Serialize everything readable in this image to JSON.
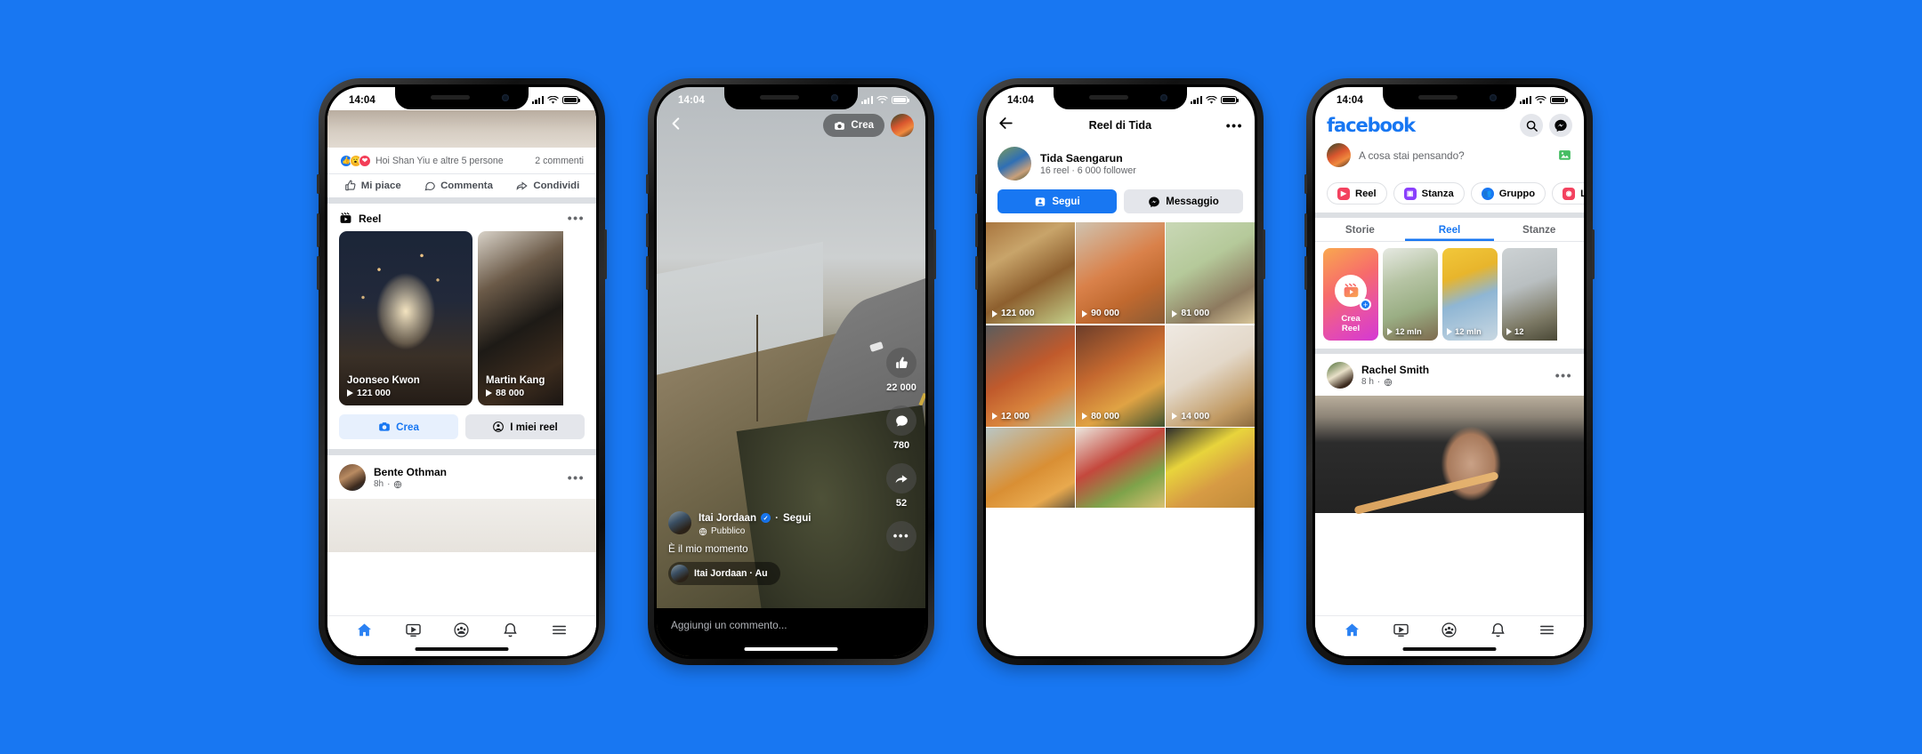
{
  "background_color": "#1877F2",
  "accent_color": "#1877F2",
  "status_bar": {
    "time": "14:04"
  },
  "phone1": {
    "name": "facebook-feed-reels-tray",
    "reactions": {
      "text": "Hoi Shan Yiu e altre 5 persone",
      "comments": "2 commenti"
    },
    "actions": [
      {
        "label": "Mi piace",
        "icon": "thumbs-up-icon"
      },
      {
        "label": "Commenta",
        "icon": "comment-icon"
      },
      {
        "label": "Condividi",
        "icon": "share-icon"
      }
    ],
    "reel_section": {
      "title": "Reel",
      "icon": "reel-icon",
      "menu": "•••"
    },
    "reel_cards": [
      {
        "name": "Joonseo Kwon",
        "plays": "121 000"
      },
      {
        "name": "Martin Kang",
        "plays": "88 000"
      }
    ],
    "cta": [
      {
        "label": "Crea",
        "icon": "camera-icon"
      },
      {
        "label": "I miei reel",
        "icon": "person-circle-icon"
      }
    ],
    "post": {
      "author": "Bente Othman",
      "time": "8h",
      "privacy": "globe-icon",
      "menu": "•••"
    },
    "tabbar": [
      "home-icon",
      "watch-icon",
      "groups-icon",
      "bell-icon",
      "menu-icon"
    ]
  },
  "phone2": {
    "name": "reel-player",
    "back": "back-chevron-icon",
    "create_chip": {
      "label": "Crea",
      "icon": "camera-icon"
    },
    "rail": [
      {
        "icon": "thumbs-up-icon",
        "count": "22 000"
      },
      {
        "icon": "comment-icon",
        "count": "780"
      },
      {
        "icon": "share-arrow-icon",
        "count": "52"
      },
      {
        "icon": "more-dots-icon",
        "count": ""
      }
    ],
    "author": "Itai Jordaan",
    "follow": "Segui",
    "privacy": "Pubblico",
    "caption": "È il mio momento",
    "audio": "Itai Jordaan · Au",
    "comment_placeholder": "Aggiungi un commento..."
  },
  "phone3": {
    "name": "profile-reels-grid",
    "nav": {
      "back": "back-arrow-icon",
      "title": "Reel di Tida",
      "menu": "•••"
    },
    "profile": {
      "name": "Tida Saengarun",
      "stats": "16 reel · 6 000 follower"
    },
    "cta": [
      {
        "label": "Segui",
        "icon": "follow-icon"
      },
      {
        "label": "Messaggio",
        "icon": "messenger-icon"
      }
    ],
    "grid": [
      {
        "plays": "121 000",
        "bg": "linear-gradient(150deg,#a9763f 0%,#c8a46a 30%,#8d5f2e 60%,#c4d08a 100%)"
      },
      {
        "plays": "90 000",
        "bg": "linear-gradient(150deg,#cfc3b0 0%,#d9814a 45%,#c0692f 70%,#8a5b34 100%)"
      },
      {
        "plays": "81 000",
        "bg": "linear-gradient(150deg,#c9d8b6 0%,#b5c99a 40%,#8d7a5f 75%,#d8c69a 100%)"
      },
      {
        "plays": "12 000",
        "bg": "linear-gradient(150deg,#5c5c5c 0%,#c05a2c 45%,#d8843d 70%,#b8c2a0 100%)"
      },
      {
        "plays": "80 000",
        "bg": "linear-gradient(150deg,#6b3d2a 0%,#c4682f 40%,#e0a344 70%,#3f5230 100%)"
      },
      {
        "plays": "14 000",
        "bg": "linear-gradient(150deg,#efe9e2 0%,#e3d8c9 45%,#c19a63 80%,#8d6b3f 100%)"
      },
      {
        "plays": "",
        "bg": "linear-gradient(150deg,#b9c6c4 0%,#d98f34 55%,#e8a94e 80%,#6b5a3e 100%)"
      },
      {
        "plays": "",
        "bg": "linear-gradient(150deg,#ece7de 0%,#c4483d 40%,#7ea34a 70%,#d9c172 100%)"
      },
      {
        "plays": "",
        "bg": "linear-gradient(150deg,#2b2b2b 0%,#e8d43c 35%,#d79b44 65%,#c08b3a 100%)"
      }
    ]
  },
  "phone4": {
    "name": "facebook-home-feed",
    "logo": "facebook",
    "header_icons": [
      "search-icon",
      "messenger-icon"
    ],
    "compose": {
      "placeholder": "A cosa stai pensando?",
      "photo_icon": "photo-icon"
    },
    "chips": [
      {
        "label": "Reel",
        "icon": "reel-icon",
        "color": "#F3425F"
      },
      {
        "label": "Stanza",
        "icon": "video-icon",
        "color": "#8A3FFC"
      },
      {
        "label": "Gruppo",
        "icon": "group-icon",
        "color": "#1877F2"
      },
      {
        "label": "Li",
        "icon": "live-icon",
        "color": "#F3425F"
      }
    ],
    "tabs": [
      {
        "label": "Storie",
        "active": false
      },
      {
        "label": "Reel",
        "active": true
      },
      {
        "label": "Stanze",
        "active": false
      }
    ],
    "create_reel": {
      "line1": "Crea",
      "line2": "Reel",
      "icon": "reel-plus-icon"
    },
    "reel_tiles": [
      {
        "plays": "12 mln",
        "bg": "linear-gradient(160deg,#e6e9e2 0%,#b6c4a4 35%,#9aae84 65%,#7d6a4e 100%)"
      },
      {
        "plays": "12 mln",
        "bg": "linear-gradient(160deg,#f2c83a 0%,#e8b52c 30%,#8fb6d4 55%,#c9d8e2 100%)"
      },
      {
        "plays": "12 ",
        "bg": "linear-gradient(160deg,#cdd2d4 0%,#b9bfc1 40%,#7d7a66 75%,#4a4836 100%)"
      }
    ],
    "post": {
      "author": "Rachel Smith",
      "time": "8 h",
      "privacy": "globe-icon",
      "menu": "•••"
    },
    "tabbar": [
      "home-icon",
      "watch-icon",
      "groups-icon",
      "bell-icon",
      "menu-icon"
    ]
  }
}
